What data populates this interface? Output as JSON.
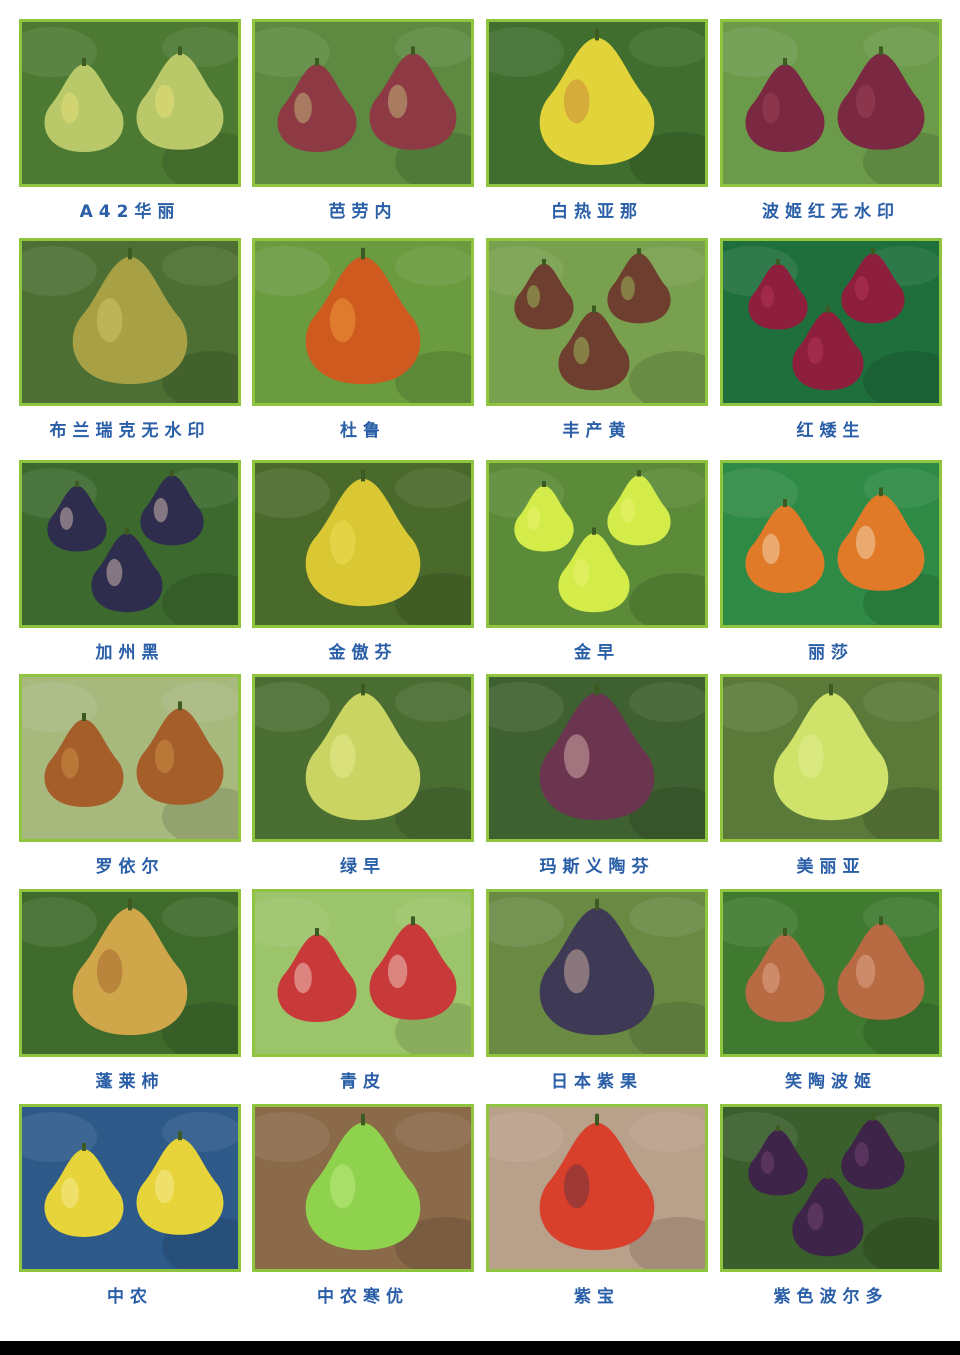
{
  "items": [
    {
      "label": "A42华丽",
      "bg": "#4d7a32",
      "fruit": "#b9c96a",
      "accent": "#f2e27a",
      "shape": "pair"
    },
    {
      "label": "芭劳内",
      "bg": "#5d8a40",
      "fruit": "#8e3a45",
      "accent": "#c9cf84",
      "shape": "pair"
    },
    {
      "label": "白热亚那",
      "bg": "#3f6e2e",
      "fruit": "#e3d33a",
      "accent": "#c47a3a",
      "shape": "single"
    },
    {
      "label": "波姬红无水印",
      "bg": "#6b9a4a",
      "fruit": "#7b2942",
      "accent": "#a2485e",
      "shape": "pair"
    },
    {
      "label": "布兰瑞克无水印",
      "bg": "#4d6f33",
      "fruit": "#a8a045",
      "accent": "#d7c96f",
      "shape": "single"
    },
    {
      "label": "杜鲁",
      "bg": "#6a9b3f",
      "fruit": "#cf5a1f",
      "accent": "#f1a43c",
      "shape": "single"
    },
    {
      "label": "丰产黄",
      "bg": "#78a04e",
      "fruit": "#6e3e2f",
      "accent": "#a4d166",
      "shape": "triple"
    },
    {
      "label": "红矮生",
      "bg": "#1f6f3d",
      "fruit": "#8e1f3c",
      "accent": "#b9385a",
      "shape": "triple"
    },
    {
      "label": "加州黑",
      "bg": "#3c6a2e",
      "fruit": "#2e2d4d",
      "accent": "#f0d2c4",
      "shape": "triple"
    },
    {
      "label": "金傲芬",
      "bg": "#4a6a2c",
      "fruit": "#dac734",
      "accent": "#f0e45a",
      "shape": "single"
    },
    {
      "label": "金早",
      "bg": "#5b8a38",
      "fruit": "#d4ec4a",
      "accent": "#eef57a",
      "shape": "triple"
    },
    {
      "label": "丽莎",
      "bg": "#2e8a45",
      "fruit": "#e07a28",
      "accent": "#f3e3c6",
      "shape": "pair"
    },
    {
      "label": "罗依尔",
      "bg": "#a8b97e",
      "fruit": "#a55d2a",
      "accent": "#d59a4a",
      "shape": "pair"
    },
    {
      "label": "绿早",
      "bg": "#4a6e32",
      "fruit": "#c9d463",
      "accent": "#eef09a",
      "shape": "single"
    },
    {
      "label": "玛斯义陶芬",
      "bg": "#3f6030",
      "fruit": "#6b3550",
      "accent": "#e6c2b6",
      "shape": "single"
    },
    {
      "label": "美丽亚",
      "bg": "#5b7a3a",
      "fruit": "#cfe36a",
      "accent": "#e5f09a",
      "shape": "single"
    },
    {
      "label": "蓬莱柿",
      "bg": "#3e6b2c",
      "fruit": "#cfa64a",
      "accent": "#9e5a2c",
      "shape": "single"
    },
    {
      "label": "青皮",
      "bg": "#9cc46a",
      "fruit": "#c83a3a",
      "accent": "#f4e2d6",
      "shape": "pair"
    },
    {
      "label": "日本紫果",
      "bg": "#6a8a44",
      "fruit": "#3e3a55",
      "accent": "#e6c2b0",
      "shape": "single"
    },
    {
      "label": "笑陶波姬",
      "bg": "#3f7a30",
      "fruit": "#b86a42",
      "accent": "#e6b49c",
      "shape": "pair"
    },
    {
      "label": "中农",
      "bg": "#2e5a8a",
      "fruit": "#e7d43a",
      "accent": "#f6f0a8",
      "shape": "pair"
    },
    {
      "label": "中农寒优",
      "bg": "#8b6a4a",
      "fruit": "#8fd24e",
      "accent": "#c5ef8a",
      "shape": "single"
    },
    {
      "label": "紫宝",
      "bg": "#b9a08a",
      "fruit": "#d8402c",
      "accent": "#5a3040",
      "shape": "single"
    },
    {
      "label": "紫色波尔多",
      "bg": "#3a5e2c",
      "fruit": "#3e2448",
      "accent": "#7a4a7a",
      "shape": "triple"
    }
  ]
}
